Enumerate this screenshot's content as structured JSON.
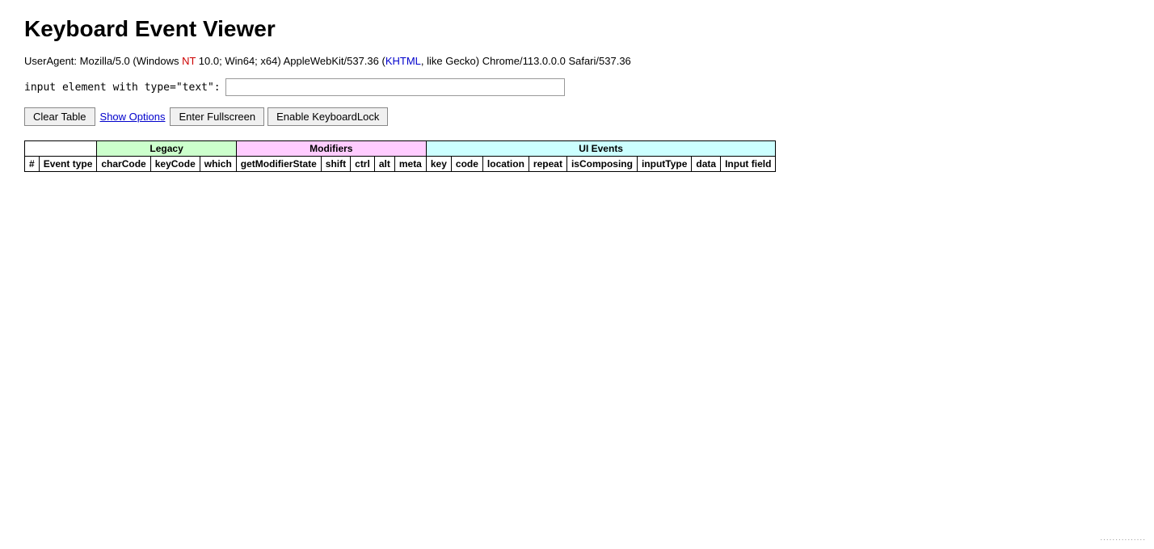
{
  "page": {
    "title": "Keyboard Event Viewer"
  },
  "user_agent": {
    "prefix": "UserAgent: Mozilla/5.0 (Windows ",
    "nt_part": "NT",
    "middle": " 10.0; Win64; x64) AppleWebKit/537.36 (",
    "khtml_part": "KHTML",
    "suffix": ", like Gecko) Chrome/113.0.0.0 Safari/537.36"
  },
  "input_label": "input element with type=\"text\":",
  "input_placeholder": "",
  "buttons": {
    "clear_table": "Clear Table",
    "show_options": "Show Options",
    "enter_fullscreen": "Enter Fullscreen",
    "enable_keyboard_lock": "Enable KeyboardLock"
  },
  "table": {
    "group_headers": {
      "legacy": "Legacy",
      "modifiers": "Modifiers",
      "ui_events": "UI Events"
    },
    "columns": [
      "#",
      "Event type",
      "charCode",
      "keyCode",
      "which",
      "getModifierState",
      "shift",
      "ctrl",
      "alt",
      "meta",
      "key",
      "code",
      "location",
      "repeat",
      "isComposing",
      "inputType",
      "data",
      "Input field"
    ]
  }
}
